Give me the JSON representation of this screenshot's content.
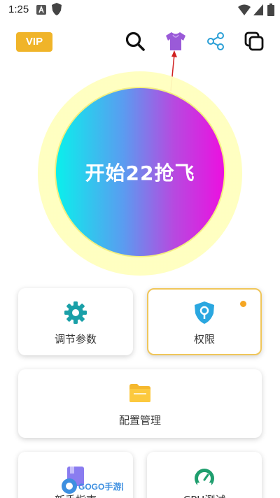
{
  "status_bar": {
    "time": "1:25"
  },
  "header": {
    "vip_label": "VIP",
    "icons": [
      "search-icon",
      "tshirt-icon",
      "share-icon",
      "copy-icon"
    ]
  },
  "start_button": {
    "label": "开始22抢飞"
  },
  "cards": {
    "adjust_params": "调节参数",
    "permissions": "权限",
    "config_manage": "配置管理",
    "guide": "新手指南",
    "cpu_test": "CPU测试"
  },
  "watermark": {
    "text": "GOGO手游网"
  },
  "colors": {
    "vip": "#f0b429",
    "accent_teal": "#1aa0a8",
    "folder": "#f5b82e",
    "notify": "#f5a623"
  }
}
